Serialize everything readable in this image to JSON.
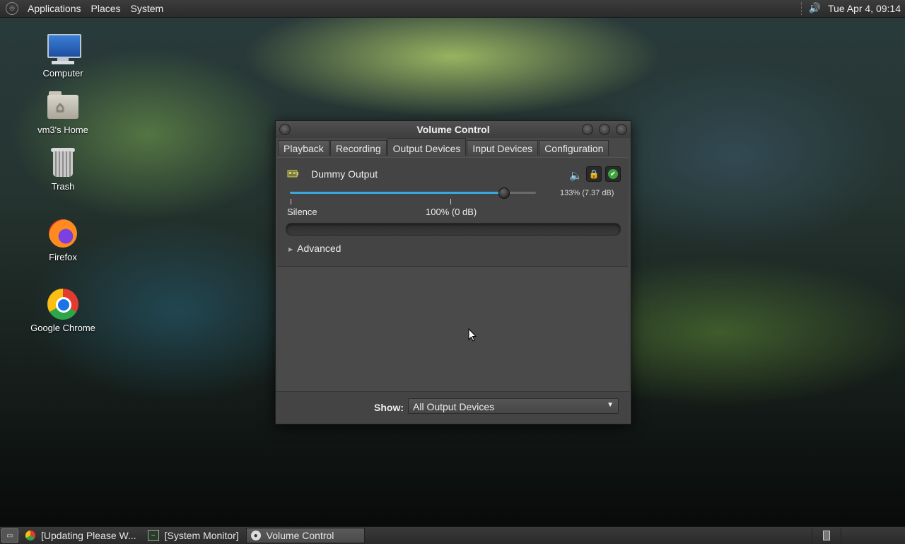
{
  "top_panel": {
    "menus": [
      "Applications",
      "Places",
      "System"
    ],
    "volume_icon": "speaker-icon",
    "clock": "Tue Apr  4, 09:14"
  },
  "desktop": {
    "icons": [
      {
        "label": "Computer",
        "icon": "computer-icon"
      },
      {
        "label": "vm3's Home",
        "icon": "home-folder-icon"
      },
      {
        "label": "Trash",
        "icon": "trash-icon"
      },
      {
        "label": "Firefox",
        "icon": "firefox-icon"
      },
      {
        "label": "Google Chrome",
        "icon": "chrome-icon"
      }
    ]
  },
  "window": {
    "title": "Volume Control",
    "tabs": [
      "Playback",
      "Recording",
      "Output Devices",
      "Input Devices",
      "Configuration"
    ],
    "active_tab": "Output Devices",
    "device": {
      "name": "Dummy Output",
      "volume_percent": 133,
      "volume_readout": "133% (7.37 dB)",
      "slider_max_percent": 153,
      "label_silence": "Silence",
      "label_100": "100% (0 dB)"
    },
    "advanced_label": "Advanced",
    "show_label": "Show:",
    "show_value": "All Output Devices"
  },
  "taskbar": {
    "tasks": [
      {
        "label": "[Updating Please W...",
        "icon": "chrome-icon",
        "active": false
      },
      {
        "label": "[System Monitor]",
        "icon": "system-monitor-icon",
        "active": false
      },
      {
        "label": "Volume Control",
        "icon": "volume-control-icon",
        "active": true
      }
    ]
  },
  "colors": {
    "slider_fill": "#39a9e0",
    "default_device_green": "#3aa53c",
    "lock_yellow": "#f2d54a"
  }
}
